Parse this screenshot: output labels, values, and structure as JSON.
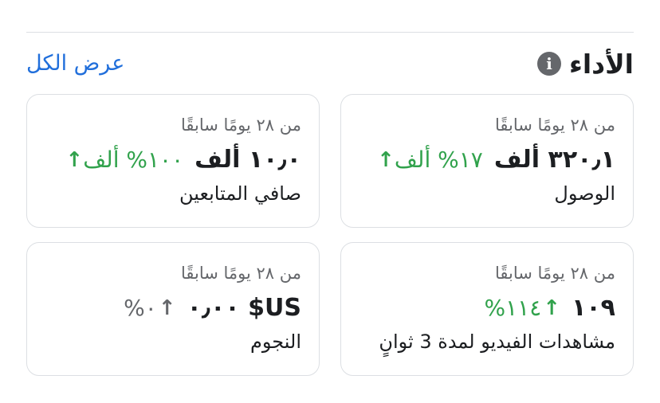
{
  "performance": {
    "title": "الأداء",
    "info_icon": "i",
    "see_all": "عرض الكل"
  },
  "cards": [
    {
      "period": "من ٢٨ يومًا سابقًا",
      "value": "٣٢٠٫١ ألف",
      "change": "١٧% ألف",
      "arrow": "↑",
      "label": "الوصول",
      "trend": "up"
    },
    {
      "period": "من ٢٨ يومًا سابقًا",
      "value": "١٠٫٠ ألف",
      "change": "١٠٠% ألف",
      "arrow": "↑",
      "label": "صافي المتابعين",
      "trend": "up"
    },
    {
      "period": "من ٢٨ يومًا سابقًا",
      "value": "١٠٩",
      "change": "١١٤%",
      "arrow": "↑",
      "label": "مشاهدات الفيديو لمدة 3 ثوانٍ",
      "trend": "up"
    },
    {
      "period": "من ٢٨ يومًا سابقًا",
      "value": "US$ ٠٫٠٠",
      "change": "٠%",
      "arrow": "↑",
      "label": "النجوم",
      "trend": "neutral"
    }
  ],
  "colors": {
    "positive": "#31a24c",
    "neutral": "#65676b",
    "link": "#216fdb"
  }
}
